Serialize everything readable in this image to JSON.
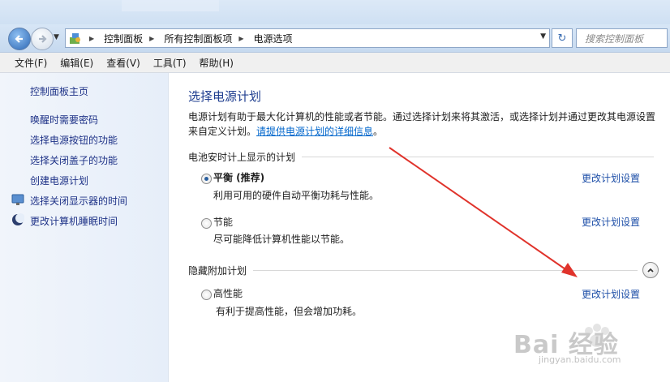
{
  "address": {
    "crumbs": [
      "控制面板",
      "所有控制面板项",
      "电源选项"
    ],
    "search_placeholder": "搜索控制面板"
  },
  "menu": [
    "文件(F)",
    "编辑(E)",
    "查看(V)",
    "工具(T)",
    "帮助(H)"
  ],
  "sidebar": {
    "home": "控制面板主页",
    "links": [
      "唤醒时需要密码",
      "选择电源按钮的功能",
      "选择关闭盖子的功能",
      "创建电源计划",
      "选择关闭显示器的时间",
      "更改计算机睡眠时间"
    ]
  },
  "main": {
    "title": "选择电源计划",
    "desc_text": "电源计划有助于最大化计算机的性能或者节能。通过选择计划来将其激活，或选择计划并通过更改其电源设置来自定义计划。",
    "desc_link": "请提供电源计划的详细信息",
    "desc_end": "。",
    "group1": "电池安时计上显示的计划",
    "group2": "隐藏附加计划",
    "plans": [
      {
        "name": "平衡 (推荐)",
        "desc": "利用可用的硬件自动平衡功耗与性能。",
        "change": "更改计划设置",
        "selected": true
      },
      {
        "name": "节能",
        "desc": "尽可能降低计算机性能以节能。",
        "change": "更改计划设置",
        "selected": false
      },
      {
        "name": "高性能",
        "desc": "有利于提高性能，但会增加功耗。",
        "change": "更改计划设置",
        "selected": false
      }
    ]
  },
  "watermark": {
    "brand": "Bai 经验",
    "url": "jingyan.baidu.com"
  },
  "colors": {
    "accent": "#1e4fa8",
    "heading": "#1e3d8f",
    "annotation_arrow": "#e0332b"
  }
}
